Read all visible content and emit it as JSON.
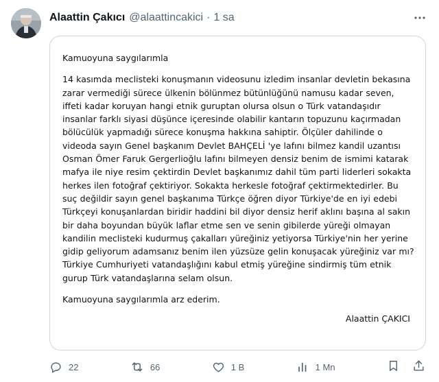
{
  "author": {
    "name": "Alaattin Çakıcı",
    "handle": "@alaattincakici",
    "separator": "·",
    "time": "1 sa"
  },
  "icons": {
    "avatar": "avatar",
    "more": "more-icon",
    "reply": "reply-icon",
    "retweet": "retweet-icon",
    "like": "like-icon",
    "views": "views-icon",
    "bookmark": "bookmark-icon",
    "share": "share-icon"
  },
  "letter": {
    "greeting": "Kamuoyuna saygılarımla",
    "body": "14 kasımda meclisteki konuşmanın videosunu izledim insanlar devletin bekasına zarar vermediği sürece ülkenin bölünmez bütünlüğünü namusu kadar seven, iffeti kadar koruyan hangi etnik guruptan olursa olsun o Türk vatandaşıdır insanlar farklı siyasi düşünce içeresinde olabilir kantarın topuzunu kaçırmadan bölücülük yapmadığı sürece konuşma hakkına sahiptir. Ölçüler dahilinde o videoda sayın Genel başkanım Devlet BAHÇELİ 'ye lafını bilmez kandil uzantısı Osman Ömer Faruk Gergerlioğlu lafını bilmeyen densiz benim de ismimi katarak mafya ile niye resim çektirdin Devlet başkanımız dahil tüm parti liderleri sokakta herkes ilen fotoğraf çektiriyor. Sokakta herkesle fotoğraf çektirmektedirler. Bu suç değildir sayın genel başkanıma Türkçe öğren diyor Türkiye'de en iyi edebi Türkçeyi konuşanlardan biridir haddini bil diyor densiz herif aklını başına al sakın bir daha boyundan büyük laflar etme sen ve senin gibilerde yüreği olmayan kandilin meclisteki kudurmuş çakalları yüreğiniz yetiyorsa Türkiye'nin her yerine gidip geliyorum adamsanız benim ilen yüzsüze gelin konuşacak yüreğiniz var mı? Türkiye Cumhuriyeti vatandaşlığını kabul etmiş yüreğine sindirmiş tüm etnik gurup Türk vatandaşlarına selam olsun.",
    "closing": "Kamuoyuna saygılarımla arz ederim.",
    "signature": "Alaattin ÇAKICI"
  },
  "stats": {
    "replies": "22",
    "retweets": "66",
    "likes": "1 B",
    "views": "1 Mn"
  },
  "colors": {
    "text": "#0f1419",
    "secondary": "#536471",
    "border": "#cfd9de"
  }
}
